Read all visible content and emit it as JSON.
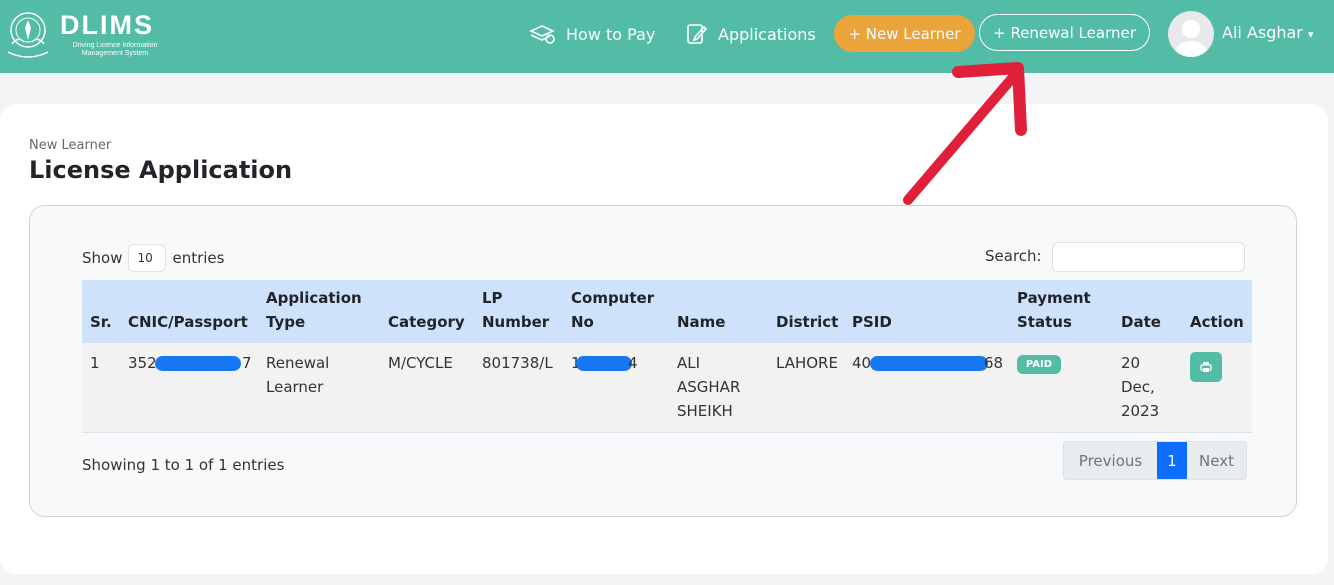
{
  "header": {
    "logo_title": "DLIMS",
    "logo_subtitle": "Driving Licence Information Management System",
    "nav": {
      "how_to_pay": "How to Pay",
      "applications": "Applications",
      "new_learner": "+ New Learner",
      "renewal_learner": "+ Renewal Learner"
    },
    "user_name": "Ali Asghar"
  },
  "page": {
    "breadcrumb": "New Learner",
    "title": "License Application"
  },
  "table_controls": {
    "show_label": "Show",
    "entries_value": "10",
    "entries_label": "entries",
    "search_label": "Search:"
  },
  "table": {
    "headers": {
      "sr": "Sr.",
      "cnic": "CNIC/Passport",
      "app_type_1": "Application",
      "app_type_2": "Type",
      "category": "Category",
      "lp_1": "LP",
      "lp_2": "Number",
      "comp_1": "Computer",
      "comp_2": "No",
      "name": "Name",
      "district": "District",
      "psid": "PSID",
      "pay_1": "Payment",
      "pay_2": "Status",
      "date": "Date",
      "action": "Action"
    },
    "row": {
      "sr": "1",
      "cnic_start": "352",
      "cnic_end": "7",
      "app_type_1": "Renewal",
      "app_type_2": "Learner",
      "category": "M/CYCLE",
      "lp_number": "801738/L",
      "comp_start": "1",
      "comp_end": "4",
      "name_1": "ALI",
      "name_2": "ASGHAR",
      "name_3": "SHEIKH",
      "district": "LAHORE",
      "psid_start": "40",
      "psid_end": "68",
      "payment_status": "PAID",
      "date_1": "20",
      "date_2": "Dec,",
      "date_3": "2023"
    }
  },
  "footer": {
    "info": "Showing 1 to 1 of 1 entries",
    "prev": "Previous",
    "page": "1",
    "next": "Next"
  },
  "colors": {
    "brand_teal": "#52bca6",
    "orange": "#eba43a",
    "header_row": "#cfe2fb",
    "redaction_blue": "#1877f2",
    "annotation_arrow": "#e0203a"
  }
}
